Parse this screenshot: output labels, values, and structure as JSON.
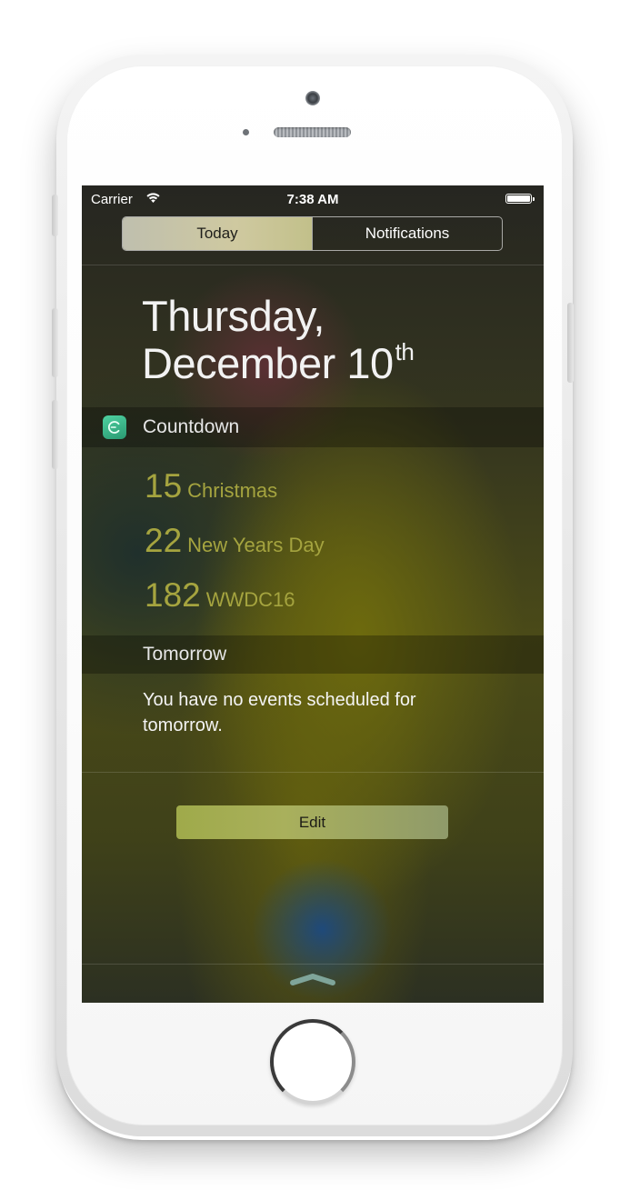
{
  "status_bar": {
    "carrier": "Carrier",
    "time": "7:38 AM",
    "wifi_icon": "wifi-icon",
    "battery_icon": "battery-icon"
  },
  "segmented_control": {
    "tabs": [
      {
        "label": "Today",
        "selected": true
      },
      {
        "label": "Notifications",
        "selected": false
      }
    ]
  },
  "date_header": {
    "weekday": "Thursday,",
    "date": "December 10",
    "ordinal_suffix": "th"
  },
  "countdown_widget": {
    "title": "Countdown",
    "icon": "countdown-app-icon",
    "items": [
      {
        "days": "15",
        "event": "Christmas"
      },
      {
        "days": "22",
        "event": "New Years Day"
      },
      {
        "days": "182",
        "event": "WWDC16"
      }
    ],
    "accent_color": "#a5a43f"
  },
  "tomorrow_widget": {
    "title": "Tomorrow",
    "message": "You have no events scheduled for tomorrow."
  },
  "edit_button": {
    "label": "Edit"
  },
  "grabber_icon": "chevron-up-icon"
}
